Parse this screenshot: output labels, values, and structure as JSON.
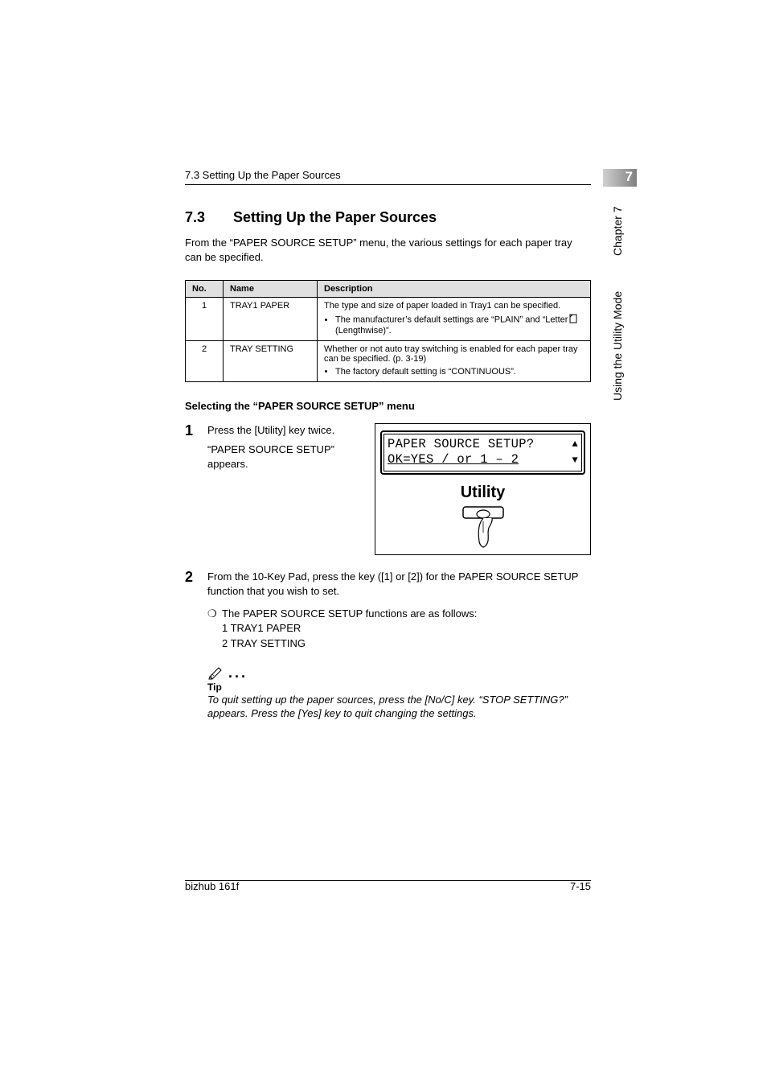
{
  "header": {
    "running": "7.3 Setting Up the Paper Sources",
    "chapter_num": "7",
    "side_chapter": "Chapter 7",
    "side_mode": "Using the Utility Mode"
  },
  "section": {
    "number": "7.3",
    "title": "Setting Up the Paper Sources",
    "intro": "From the “PAPER SOURCE SETUP” menu, the various settings for each paper tray can be specified."
  },
  "table": {
    "headers": {
      "no": "No.",
      "name": "Name",
      "desc": "Description"
    },
    "rows": [
      {
        "no": "1",
        "name": "TRAY1 PAPER",
        "desc_main": "The type and size of paper loaded in Tray1 can be specified.",
        "bullets": [
          "The manufacturer’s default settings are “PLAIN” and “Letter ▯ (Lengthwise)”."
        ]
      },
      {
        "no": "2",
        "name": "TRAY SETTING",
        "desc_main": "Whether or not auto tray switching is enabled for each paper tray can be specified. (p. 3-19)",
        "bullets": [
          "The factory default setting is “CONTINUOUS”."
        ]
      }
    ]
  },
  "procedure": {
    "heading": "Selecting the “PAPER SOURCE SETUP” menu",
    "step1": {
      "num": "1",
      "line1": "Press the [Utility] key twice.",
      "line2": "“PAPER SOURCE SETUP” appears."
    },
    "lcd": {
      "line1": "PAPER SOURCE SETUP?",
      "line2": "OK=YES / or 1 – 2",
      "utility_label": "Utility"
    },
    "step2": {
      "num": "2",
      "text": "From the 10-Key Pad, press the key ([1] or [2]) for the PAPER SOURCE SETUP function that you wish to set.",
      "sub_marker": "❍",
      "sub_text": "The PAPER SOURCE SETUP functions are as follows:",
      "sub_lines": [
        "1 TRAY1 PAPER",
        "2 TRAY SETTING"
      ]
    },
    "tip": {
      "label": "Tip",
      "text": "To quit setting up the paper sources, press the [No/C] key. “STOP SETTING?” appears. Press the [Yes] key to quit changing the settings."
    }
  },
  "footer": {
    "product": "bizhub 161f",
    "page": "7-15"
  }
}
